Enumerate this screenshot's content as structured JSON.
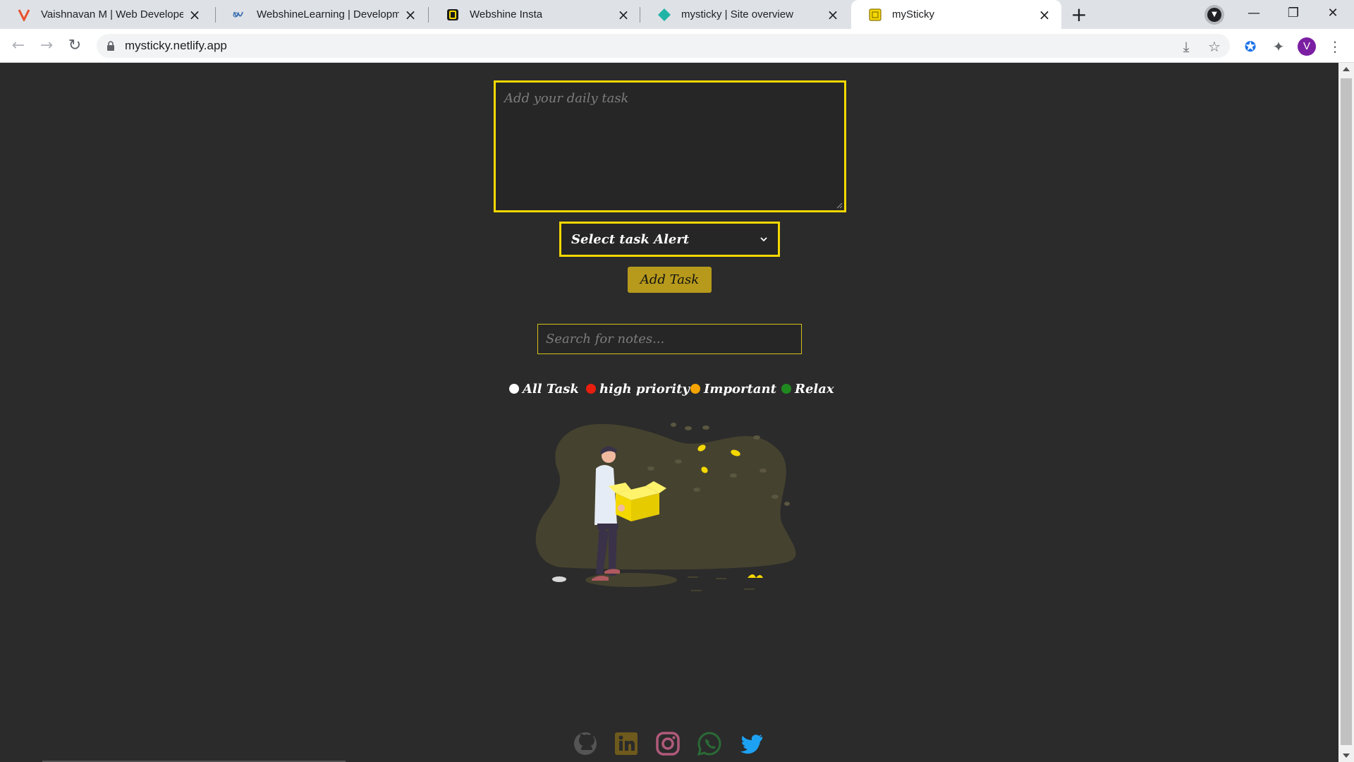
{
  "browser": {
    "tabs": [
      {
        "title": "Vaishnavan M | Web Developer",
        "icon": "v-logo-icon",
        "active": false
      },
      {
        "title": "WebshineLearning | Developmen",
        "icon": "w-logo-icon",
        "active": false
      },
      {
        "title": "Webshine Insta",
        "icon": "insta-logo-icon",
        "active": false
      },
      {
        "title": "mysticky | Site overview",
        "icon": "netlify-icon",
        "active": false
      },
      {
        "title": "mySticky",
        "icon": "sticky-logo-icon",
        "active": true
      }
    ],
    "url": "mysticky.netlify.app",
    "profile_initial": "V"
  },
  "app": {
    "task_placeholder": "Add your daily task",
    "alert_select": {
      "selected": "Select task Alert"
    },
    "add_button": "Add Task",
    "search_placeholder": "Search for notes...",
    "filters": [
      {
        "label": "All Task",
        "color": "#ffffff"
      },
      {
        "label": "high priority",
        "color": "#e81e0e"
      },
      {
        "label": "Important",
        "color": "#f5a300"
      },
      {
        "label": "Relax",
        "color": "#1f8a1f"
      }
    ],
    "accent": "#f4d800",
    "socials": [
      {
        "name": "github-icon",
        "color": "#555555"
      },
      {
        "name": "linkedin-icon",
        "color": "#6e5a1c"
      },
      {
        "name": "instagram-icon",
        "color": "#b05a7a"
      },
      {
        "name": "whatsapp-icon",
        "color": "#2a6a36"
      },
      {
        "name": "twitter-icon",
        "color": "#1da1f2"
      }
    ]
  }
}
